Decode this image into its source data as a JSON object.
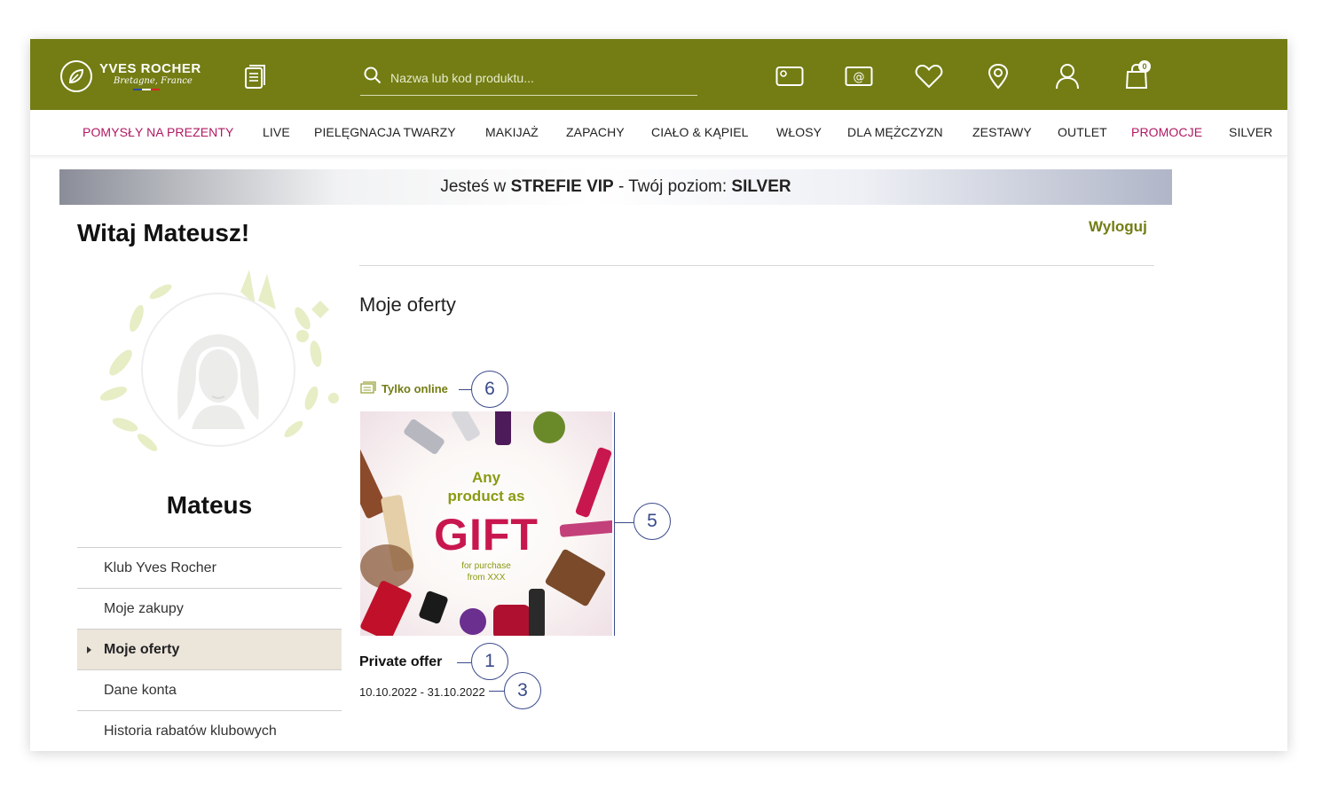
{
  "header": {
    "brand_line1": "YVES ROCHER",
    "brand_line2": "Bretagne, France",
    "search_placeholder": "Nazwa lub kod produktu...",
    "cart_count": "0",
    "icons": [
      "catalog-icon",
      "search-icon",
      "gift-card-icon",
      "email-icon",
      "heart-icon",
      "location-pin-icon",
      "user-icon",
      "shopping-bag-icon"
    ],
    "brand_color": "#737d14"
  },
  "nav": {
    "items": [
      {
        "label": "POMYSŁY NA PREZENTY",
        "highlight": true
      },
      {
        "label": "LIVE",
        "highlight": false
      },
      {
        "label": "PIELĘGNACJA TWARZY",
        "highlight": false
      },
      {
        "label": "MAKIJAŻ",
        "highlight": false
      },
      {
        "label": "ZAPACHY",
        "highlight": false
      },
      {
        "label": "CIAŁO & KĄPIEL",
        "highlight": false
      },
      {
        "label": "WŁOSY",
        "highlight": false
      },
      {
        "label": "DLA MĘŻCZYZN",
        "highlight": false
      },
      {
        "label": "ZESTAWY",
        "highlight": false
      },
      {
        "label": "OUTLET",
        "highlight": false
      },
      {
        "label": "PROMOCJE",
        "highlight": true
      },
      {
        "label": "SILVER",
        "highlight": false
      }
    ],
    "highlight_color": "#b01862"
  },
  "vip_banner": {
    "prefix": "Jesteś w",
    "zone": "STREFIE VIP",
    "middle": "- Twój poziom:",
    "level": "SILVER"
  },
  "account": {
    "greeting": "Witaj Mateusz!",
    "logout_label": "Wyloguj",
    "profile_name": "Mateus"
  },
  "side_menu": {
    "items": [
      {
        "label": "Klub Yves Rocher",
        "active": false
      },
      {
        "label": "Moje zakupy",
        "active": false
      },
      {
        "label": "Moje oferty",
        "active": true
      },
      {
        "label": "Dane konta",
        "active": false
      },
      {
        "label": "Historia rabatów klubowych",
        "active": false
      }
    ]
  },
  "main": {
    "section_title": "Moje oferty",
    "offer": {
      "channel_label": "Tylko online",
      "image_line1": "Any",
      "image_line2": "product as",
      "image_headline": "GIFT",
      "image_small1": "for purchase",
      "image_small2": "from XXX",
      "title": "Private offer",
      "dates": "10.10.2022 - 31.10.2022"
    }
  },
  "callouts": [
    "6",
    "5",
    "1",
    "3"
  ],
  "callout_color": "#3a4a8a"
}
